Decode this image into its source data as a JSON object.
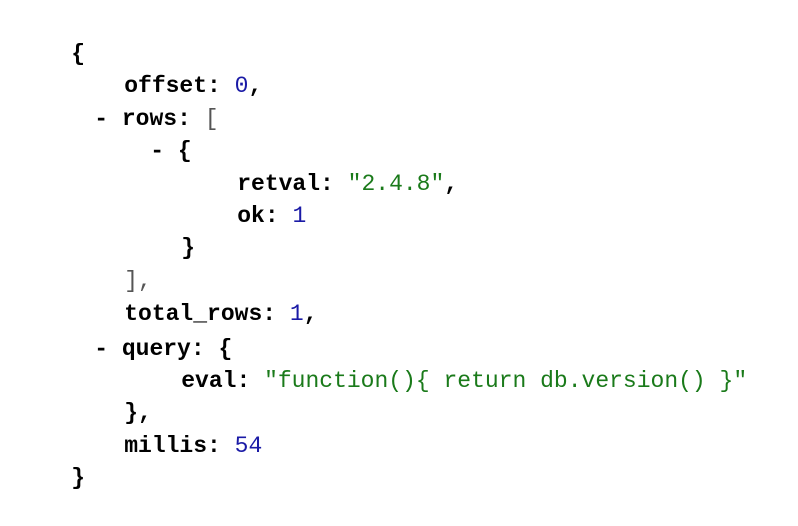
{
  "viewer": {
    "lines": {
      "open_root": "{",
      "offset": {
        "key": "offset",
        "colon": ":",
        "value": "0",
        "comma": ","
      },
      "rows": {
        "toggle": "-",
        "key": "rows",
        "colon": ":",
        "open": "["
      },
      "row0": {
        "toggle": "-",
        "open": "{"
      },
      "retval": {
        "key": "retval",
        "colon": ":",
        "value": "\"2.4.8\"",
        "comma": ","
      },
      "ok": {
        "key": "ok",
        "colon": ":",
        "value": "1"
      },
      "row0_close": "}",
      "rows_close": "],",
      "total_rows": {
        "key": "total_rows",
        "colon": ":",
        "value": "1",
        "comma": ","
      },
      "query": {
        "toggle": "-",
        "key": "query",
        "colon": ":",
        "open": "{"
      },
      "eval": {
        "key": "eval",
        "colon": ":",
        "value": "\"function(){ return db.version() }\""
      },
      "query_close": "},",
      "millis": {
        "key": "millis",
        "colon": ":",
        "value": "54"
      },
      "close_root": "}"
    }
  },
  "colors": {
    "number": "#1a1aa6",
    "string": "#1a7a1a",
    "bracket": "#555555",
    "key": "#000000"
  }
}
